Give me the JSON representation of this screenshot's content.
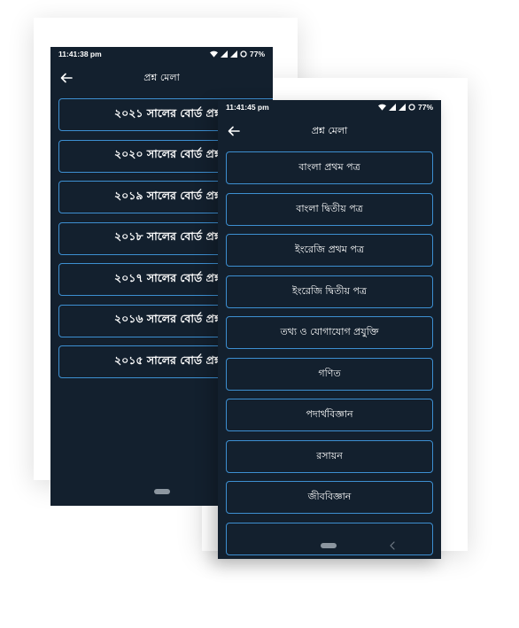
{
  "back_screen": {
    "status_time": "11:41:38 pm",
    "battery": "77%",
    "title": "প্রশ্ন মেলা",
    "items": [
      "২০২১ সালের বোর্ড প্রশ্ন",
      "২০২০ সালের বোর্ড প্রশ্ন",
      "২০১৯ সালের বোর্ড প্রশ্ন",
      "২০১৮ সালের বোর্ড প্রশ্ন",
      "২০১৭ সালের বোর্ড প্রশ্ন",
      "২০১৬ সালের বোর্ড প্রশ্ন",
      "২০১৫ সালের বোর্ড প্রশ্ন"
    ]
  },
  "front_screen": {
    "status_time": "11:41:45 pm",
    "battery": "77%",
    "title": "প্রশ্ন মেলা",
    "items": [
      "বাংলা প্রথম পত্র",
      "বাংলা দ্বিতীয় পত্র",
      "ইংরেজি প্রথম পত্র",
      "ইংরেজি দ্বিতীয় পত্র",
      "তথ্য ও যোগাযোগ প্রযুক্তি",
      "গণিত",
      "পদার্থবিজ্ঞান",
      "রসায়ন",
      "জীববিজ্ঞান",
      ""
    ]
  },
  "icons": {
    "back": "arrow-left-icon",
    "wifi": "wifi-icon",
    "signal": "signal-icon",
    "battery": "battery-icon",
    "nav_back": "chevron-left-icon"
  },
  "colors": {
    "screen_bg": "#13202e",
    "item_border": "#3d8fd1",
    "text": "#ffffff"
  }
}
